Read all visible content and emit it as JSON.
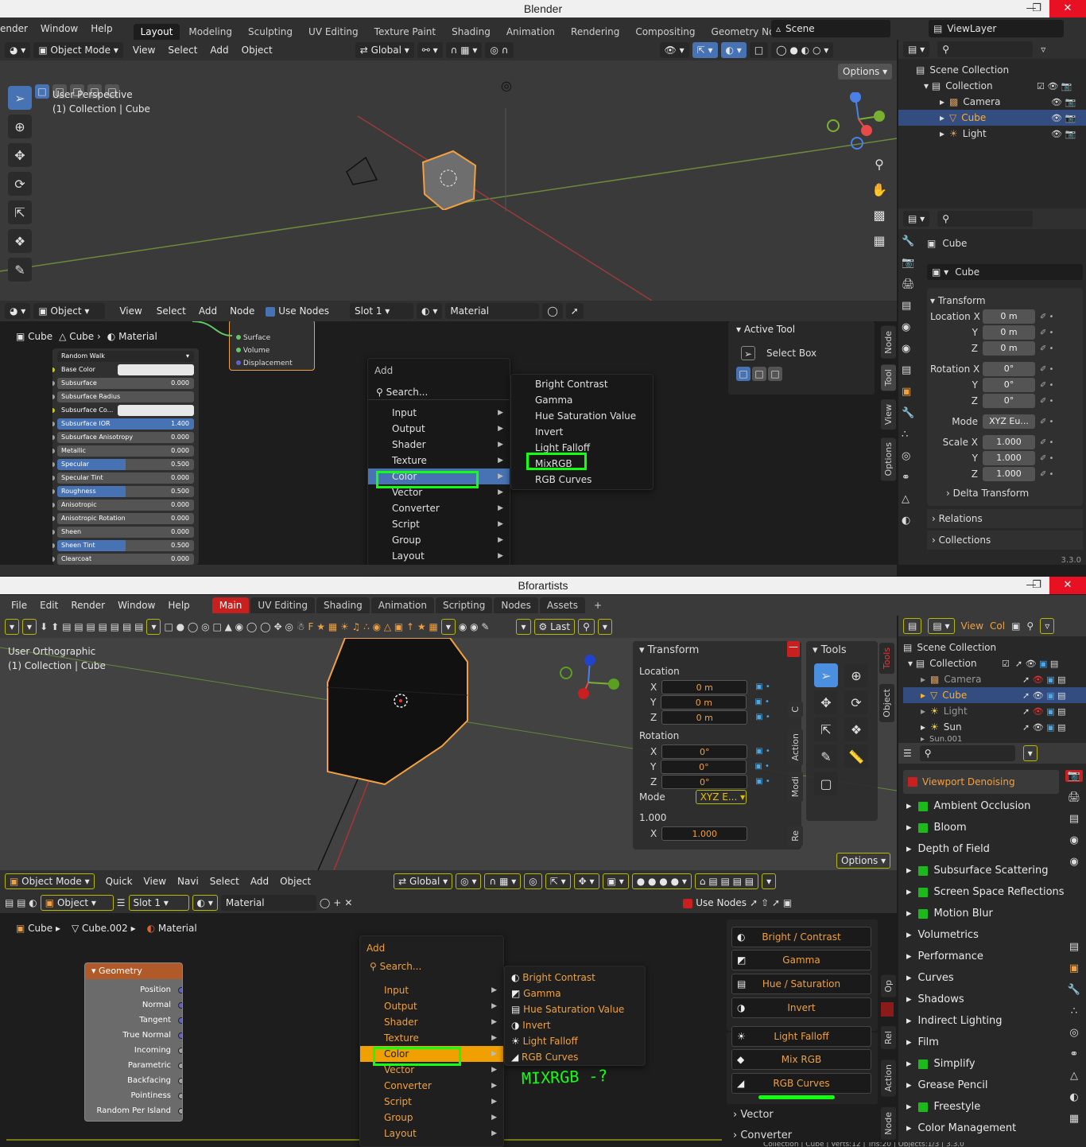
{
  "top": {
    "window_title": "Blender",
    "menus": [
      "ender",
      "Window",
      "Help"
    ],
    "workspaces": [
      "Layout",
      "Modeling",
      "Sculpting",
      "UV Editing",
      "Texture Paint",
      "Shading",
      "Animation",
      "Rendering",
      "Compositing",
      "Geometry Nodes"
    ],
    "scene": "Scene",
    "view_layer": "ViewLayer",
    "vp_header": {
      "mode": "Object Mode",
      "items": [
        "View",
        "Select",
        "Add",
        "Object"
      ],
      "orientation": "Global",
      "options": "Options"
    },
    "vp_info": [
      "User Perspective",
      "(1) Collection | Cube"
    ],
    "outliner": {
      "root": "Scene Collection",
      "collection": "Collection",
      "items": [
        "Camera",
        "Cube",
        "Light"
      ]
    },
    "props": {
      "object_name": "Cube",
      "data_name": "Cube",
      "transform": "Transform",
      "location_label": "Location X",
      "rotation_label": "Rotation X",
      "scale_label": "Scale X",
      "y": "Y",
      "z": "Z",
      "loc": [
        "0 m",
        "0 m",
        "0 m"
      ],
      "rot": [
        "0°",
        "0°",
        "0°"
      ],
      "mode_label": "Mode",
      "mode": "XYZ Eu...",
      "scale": [
        "1.000",
        "1.000",
        "1.000"
      ],
      "delta": "Delta Transform",
      "relations": "Relations",
      "collections": "Collections"
    },
    "node_header": {
      "object": "Object",
      "items": [
        "View",
        "Select",
        "Add",
        "Node"
      ],
      "use_nodes": "Use Nodes",
      "slot": "Slot 1",
      "material": "Material"
    },
    "breadcrumb": [
      "Cube",
      "Cube",
      "Material"
    ],
    "bsdf": {
      "subsurface_method": "Random Walk",
      "props": [
        {
          "name": "Base Color",
          "value": ""
        },
        {
          "name": "Subsurface",
          "value": "0.000"
        },
        {
          "name": "Subsurface Radius",
          "value": ""
        },
        {
          "name": "Subsurface Co...",
          "value": ""
        },
        {
          "name": "Subsurface IOR",
          "value": "1.400"
        },
        {
          "name": "Subsurface Anisotropy",
          "value": "0.000"
        },
        {
          "name": "Metallic",
          "value": "0.000"
        },
        {
          "name": "Specular",
          "value": "0.500"
        },
        {
          "name": "Specular Tint",
          "value": "0.000"
        },
        {
          "name": "Roughness",
          "value": "0.500"
        },
        {
          "name": "Anisotropic",
          "value": "0.000"
        },
        {
          "name": "Anisotropic Rotation",
          "value": "0.000"
        },
        {
          "name": "Sheen",
          "value": "0.000"
        },
        {
          "name": "Sheen Tint",
          "value": "0.500"
        },
        {
          "name": "Clearcoat",
          "value": "0.000"
        }
      ]
    },
    "output_node": {
      "sockets": [
        "Surface",
        "Volume",
        "Displacement"
      ]
    },
    "add_menu": {
      "title": "Add",
      "search": "Search...",
      "items": [
        "Input",
        "Output",
        "Shader",
        "Texture",
        "Color",
        "Vector",
        "Converter",
        "Script",
        "Group",
        "Layout"
      ]
    },
    "color_submenu": [
      "Bright Contrast",
      "Gamma",
      "Hue Saturation Value",
      "Invert",
      "Light Falloff",
      "MixRGB",
      "RGB Curves"
    ],
    "sidebar": {
      "active_tool": "Active Tool",
      "tool": "Select Box",
      "tabs": [
        "Node",
        "Tool",
        "View",
        "Options"
      ]
    },
    "version": "3.3.0"
  },
  "bottom": {
    "window_title": "Bforartists",
    "menus": [
      "File",
      "Edit",
      "Render",
      "Window",
      "Help"
    ],
    "workspaces": [
      "Main",
      "UV Editing",
      "Shading",
      "Animation",
      "Scripting",
      "Nodes",
      "Assets"
    ],
    "last": "Last",
    "vp_info": [
      "User Orthographic",
      "(1) Collection | Cube"
    ],
    "transform": {
      "title": "Transform",
      "location": "Location",
      "rotation": "Rotation",
      "scale": [
        "1.000"
      ],
      "mode_label": "Mode",
      "mode": "XYZ E...",
      "axes": [
        "X",
        "Y",
        "Z"
      ],
      "loc": [
        "0 m",
        "0 m",
        "0 m"
      ],
      "rot": [
        "0°",
        "0°",
        "0°"
      ]
    },
    "tools_title": "Tools",
    "vp_tabs": [
      "C",
      "Action",
      "Modi",
      "Re"
    ],
    "options": "Options",
    "header": {
      "mode": "Object Mode",
      "items": [
        "Quick",
        "View",
        "Navi",
        "Select",
        "Add",
        "Object"
      ],
      "orientation": "Global"
    },
    "node_header": {
      "object": "Object",
      "slot": "Slot 1",
      "material": "Material",
      "use_nodes": "Use Nodes"
    },
    "breadcrumb": [
      "Cube",
      "Cube.002",
      "Material"
    ],
    "geometry_node": {
      "title": "Geometry",
      "outputs": [
        "Position",
        "Normal",
        "Tangent",
        "True Normal",
        "Incoming",
        "Parametric",
        "Backfacing",
        "Pointiness",
        "Random Per Island"
      ]
    },
    "add_menu": {
      "title": "Add",
      "search": "Search...",
      "items": [
        "Input",
        "Output",
        "Shader",
        "Texture",
        "Color",
        "Vector",
        "Converter",
        "Script",
        "Group",
        "Layout"
      ]
    },
    "color_submenu": [
      "Bright Contrast",
      "Gamma",
      "Hue Saturation Value",
      "Invert",
      "Light Falloff",
      "RGB Curves"
    ],
    "annotation": "MIXRGB -?",
    "tool_shelf": [
      "Bright / Contrast",
      "Gamma",
      "Hue / Saturation",
      "Invert",
      "Light Falloff",
      "Mix RGB",
      "RGB Curves"
    ],
    "shelf_sections": [
      "Vector",
      "Converter"
    ],
    "shelf_tabs": [
      "Op",
      "Rel",
      "Action",
      "Node"
    ],
    "outliner": {
      "root": "Scene Collection",
      "collection": "Collection",
      "items": [
        "Camera",
        "Cube",
        "Light",
        "Sun",
        "Sun.001"
      ],
      "header": [
        "View",
        "Col"
      ]
    },
    "viewport_denoising": "Viewport Denoising",
    "eevee": [
      "Ambient Occlusion",
      "Bloom",
      "Depth of Field",
      "Subsurface Scattering",
      "Screen Space Reflections",
      "Motion Blur",
      "Volumetrics",
      "Performance",
      "Curves",
      "Shadows",
      "Indirect Lighting",
      "Film",
      "Simplify",
      "Grease Pencil",
      "Freestyle",
      "Color Management"
    ],
    "status": "Collection | Cube | Verts:12 | Tris:20 | Objects:1/3 | 3.3.0"
  }
}
